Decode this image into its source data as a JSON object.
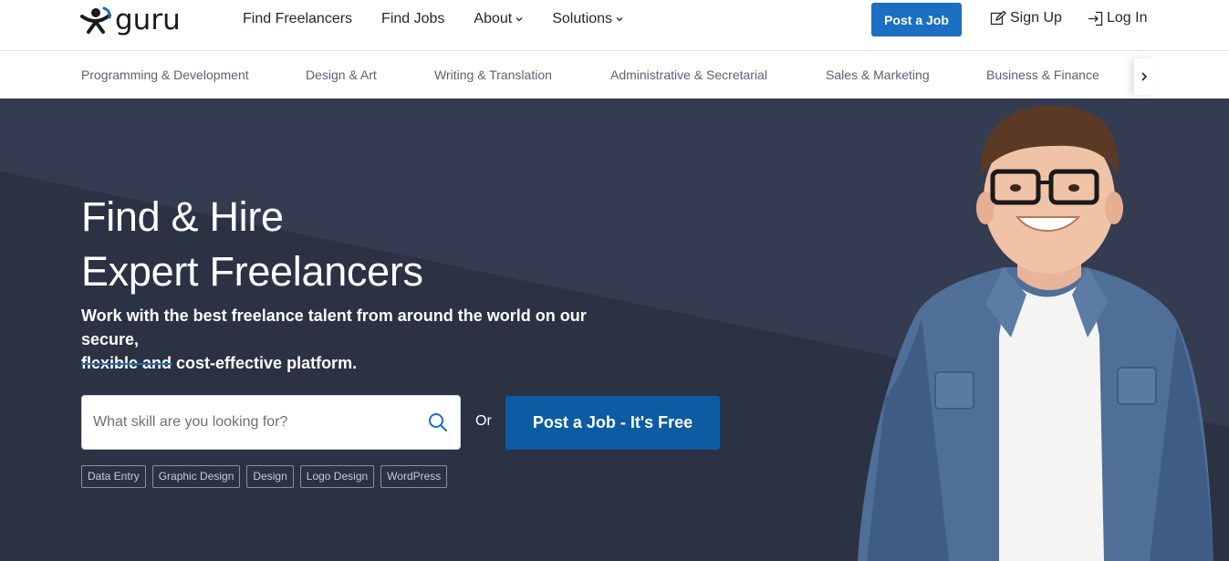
{
  "logo": {
    "text": "guru"
  },
  "nav": {
    "links": [
      {
        "label": "Find Freelancers",
        "dropdown": false
      },
      {
        "label": "Find Jobs",
        "dropdown": false
      },
      {
        "label": "About",
        "dropdown": true
      },
      {
        "label": "Solutions",
        "dropdown": true
      }
    ],
    "post_job": "Post a Job",
    "sign_up": "Sign Up",
    "log_in": "Log In"
  },
  "categories": [
    "Programming & Development",
    "Design & Art",
    "Writing & Translation",
    "Administrative & Secretarial",
    "Sales & Marketing",
    "Business & Finance"
  ],
  "hero": {
    "title_line1": "Find & Hire",
    "title_line2": "Expert Freelancers",
    "subtitle_line1": "Work with the best freelance talent from around the world on our secure,",
    "subtitle_line2": "flexible and cost-effective platform.",
    "search_placeholder": "What skill are you looking for?",
    "or": "Or",
    "post_job_cta": "Post a Job - It's Free",
    "tags": [
      "Data Entry",
      "Graphic Design",
      "Design",
      "Logo Design",
      "WordPress"
    ]
  },
  "colors": {
    "brand_blue": "#1b6ec2",
    "cta_blue": "#0d5ba3",
    "hero_bg": "#2b3244",
    "hero_bg_light": "#343c51"
  },
  "icons": {
    "search": "search-icon",
    "sign_up": "edit-icon",
    "log_in": "login-icon",
    "next": "chevron-right-icon",
    "dropdown": "chevron-down-icon"
  }
}
